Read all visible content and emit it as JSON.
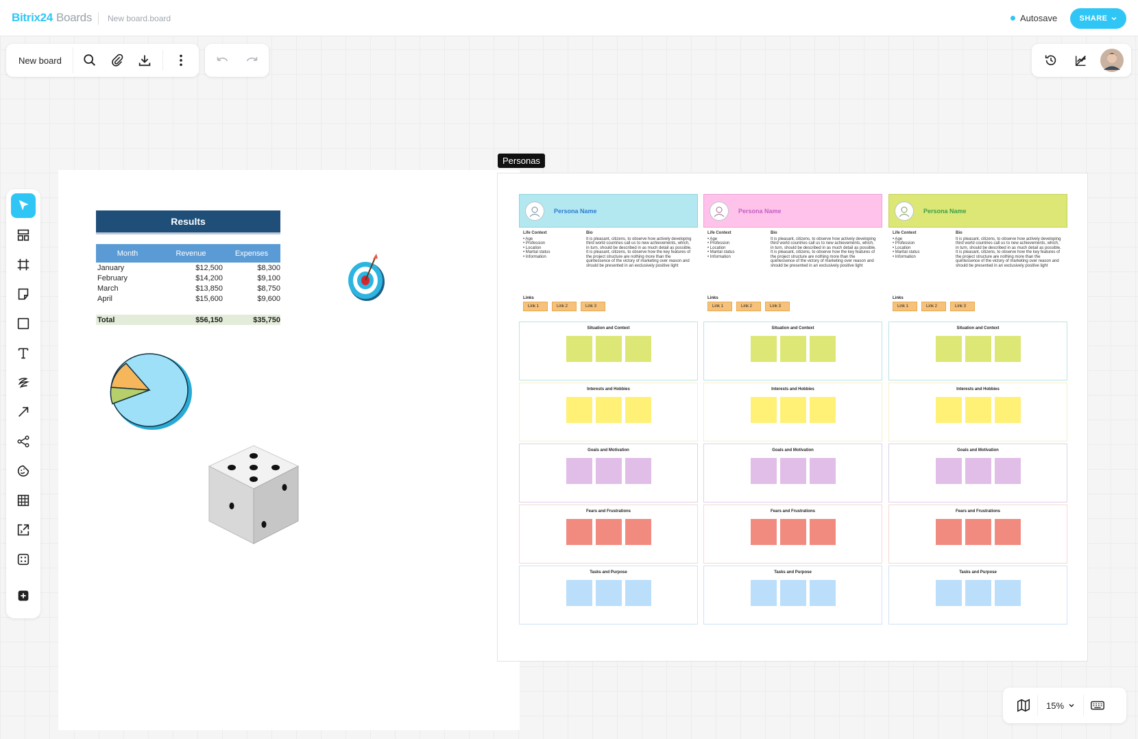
{
  "header": {
    "logo_brand": "Bitrix24",
    "logo_product": "Boards",
    "doc_name": "New board.board",
    "autosave_label": "Autosave",
    "share_label": "SHARE"
  },
  "toolbar": {
    "board_label": "New board",
    "icons": [
      "search-icon",
      "attach-icon",
      "download-icon",
      "more-icon",
      "undo-icon",
      "redo-icon"
    ]
  },
  "right_toolbar": {
    "icons": [
      "history-icon",
      "hide-comments-icon",
      "user-avatar"
    ]
  },
  "left_tools": [
    "select",
    "templates",
    "frame",
    "sticky-note",
    "shape",
    "text",
    "pen",
    "arrow",
    "mind-map",
    "sticker",
    "table",
    "embed",
    "dice",
    "add"
  ],
  "results_table": {
    "title": "Results",
    "columns": [
      "Month",
      "Revenue",
      "Expenses"
    ],
    "rows": [
      [
        "January",
        "$12,500",
        "$8,300"
      ],
      [
        "February",
        "$14,200",
        "$9,100"
      ],
      [
        "March",
        "$13,850",
        "$8,750"
      ],
      [
        "April",
        "$15,600",
        "$9,600"
      ]
    ],
    "total": [
      "Total",
      "$56,150",
      "$35,750"
    ]
  },
  "frame_label": "Personas",
  "personas": [
    {
      "name": "Persona Name",
      "header_color": "#b4e8f0",
      "name_color": "#2b7cd3"
    },
    {
      "name": "Persona Name",
      "header_color": "#ffc2ea",
      "name_color": "#c45fc4"
    },
    {
      "name": "Persona Name",
      "header_color": "#dce775",
      "name_color": "#3aa04a"
    }
  ],
  "persona_common": {
    "life_context_title": "Life Context",
    "life_context_items": [
      "• Age",
      "• Profession",
      "• Location",
      "• Marital status",
      "• Information"
    ],
    "bio_titles": [
      "Bio",
      "Bio",
      "Bio"
    ],
    "bio_text": "It is pleasant, citizens, to observe how actively developing third world countries call us to new achievements, which, in turn, should be described in as much detail as possible. It is pleasant, citizens, to observe how the key features of the project structure are nothing more than the quintessence of the victory of marketing over reason and should be presented in an exclusively positive light",
    "links_title": "Links",
    "links": [
      "Link 1",
      "Link 2",
      "Link 3"
    ]
  },
  "sections": [
    {
      "title": "Situation and Context",
      "color": "#dce775",
      "border": "#b9e4ea"
    },
    {
      "title": "Interests and Hobbies",
      "color": "#fff176",
      "border": "#f6f0c8"
    },
    {
      "title": "Goals and Motivation",
      "color": "#e1bee7",
      "border": "#ddd0ea"
    },
    {
      "title": "Fears and Frustrations",
      "color": "#f28b7f",
      "border": "#f6d7d4"
    },
    {
      "title": "Tasks and Purpose",
      "color": "#bbdefb",
      "border": "#cfe3f5"
    }
  ],
  "zoom": {
    "level": "15%"
  }
}
